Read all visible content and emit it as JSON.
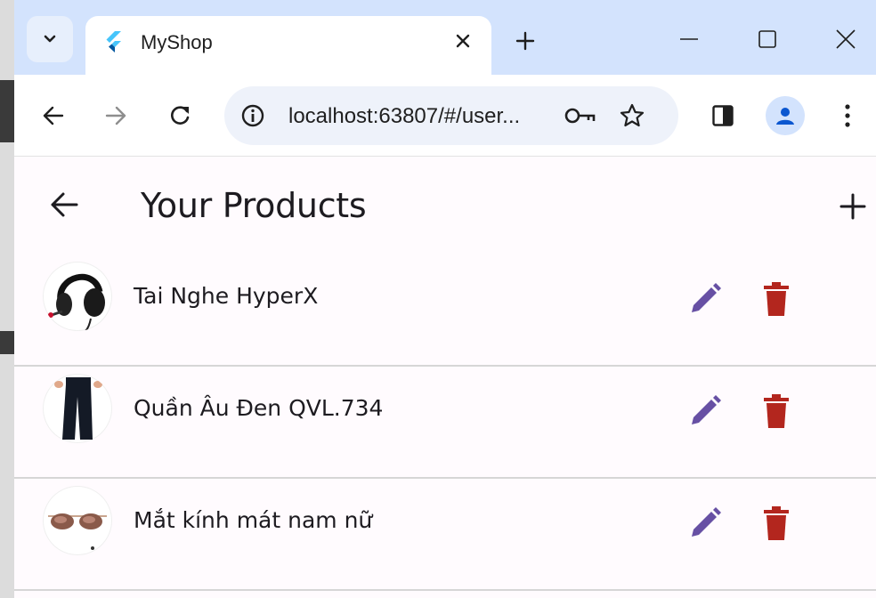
{
  "browser": {
    "tab_title": "MyShop",
    "url": "localhost:63807/#/user...",
    "colors": {
      "tabstrip": "#d3e3fd",
      "accent": "#1a73e8"
    },
    "icons": [
      "tab-search-icon",
      "flutter-favicon-icon",
      "close-icon",
      "plus-icon",
      "minimize-icon",
      "maximize-icon",
      "window-close-icon",
      "back-arrow-icon",
      "forward-arrow-icon",
      "reload-icon",
      "info-icon",
      "key-icon",
      "star-icon",
      "side-panel-icon",
      "profile-icon",
      "more-vert-icon"
    ]
  },
  "app": {
    "title": "Your Products",
    "colors": {
      "edit": "#6750a4",
      "delete": "#b3261e",
      "background": "#fffbfe"
    },
    "products": [
      {
        "name": "Tai Nghe HyperX",
        "image": "headset"
      },
      {
        "name": "Quần Âu Đen QVL.734",
        "image": "trousers"
      },
      {
        "name": "Mắt kính mát nam nữ",
        "image": "sunglasses"
      }
    ]
  }
}
